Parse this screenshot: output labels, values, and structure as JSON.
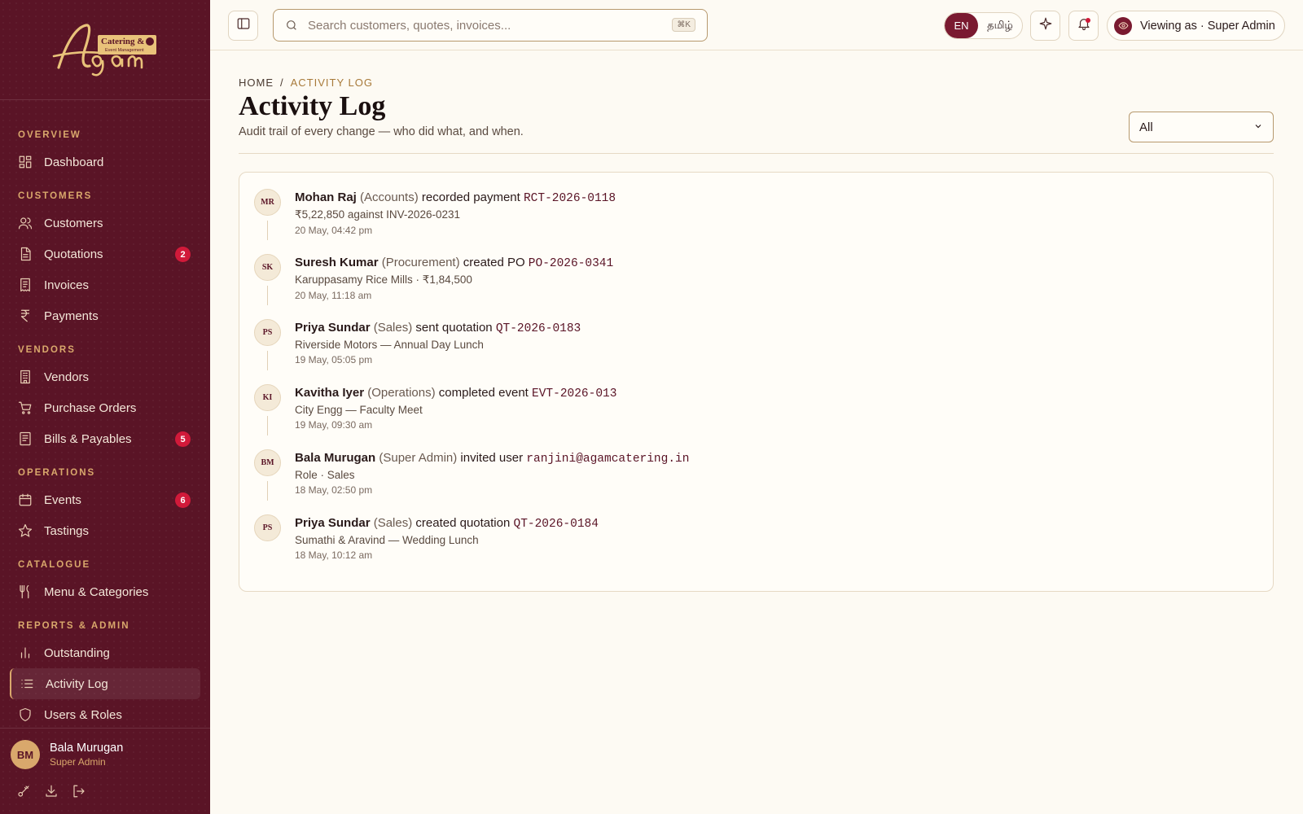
{
  "brand": {
    "logo_line1": "Catering &",
    "logo_line2": "Event Management",
    "logo_script": "Agam"
  },
  "sidebar": {
    "sections": [
      {
        "title": "OVERVIEW",
        "items": [
          {
            "label": "Dashboard",
            "icon": "dashboard-icon"
          }
        ]
      },
      {
        "title": "CUSTOMERS",
        "items": [
          {
            "label": "Customers",
            "icon": "users-icon"
          },
          {
            "label": "Quotations",
            "icon": "file-icon",
            "badge": "2"
          },
          {
            "label": "Invoices",
            "icon": "receipt-icon"
          },
          {
            "label": "Payments",
            "icon": "rupee-icon"
          }
        ]
      },
      {
        "title": "VENDORS",
        "items": [
          {
            "label": "Vendors",
            "icon": "building-icon"
          },
          {
            "label": "Purchase Orders",
            "icon": "cart-icon"
          },
          {
            "label": "Bills & Payables",
            "icon": "bill-icon",
            "badge": "5"
          }
        ]
      },
      {
        "title": "OPERATIONS",
        "items": [
          {
            "label": "Events",
            "icon": "calendar-icon",
            "badge": "6"
          },
          {
            "label": "Tastings",
            "icon": "star-icon"
          }
        ]
      },
      {
        "title": "CATALOGUE",
        "items": [
          {
            "label": "Menu & Categories",
            "icon": "utensils-icon"
          }
        ]
      },
      {
        "title": "REPORTS & ADMIN",
        "items": [
          {
            "label": "Outstanding",
            "icon": "bar-chart-icon"
          },
          {
            "label": "Activity Log",
            "icon": "list-icon",
            "active": true
          },
          {
            "label": "Users & Roles",
            "icon": "shield-icon"
          }
        ]
      }
    ],
    "user": {
      "initials": "BM",
      "name": "Bala Murugan",
      "role": "Super Admin"
    }
  },
  "topbar": {
    "search_placeholder": "Search customers, quotes, invoices...",
    "shortcut": "⌘K",
    "lang_en": "EN",
    "lang_ta": "தமிழ்",
    "viewing_as": "Viewing as · Super Admin"
  },
  "page": {
    "breadcrumb_home": "HOME",
    "breadcrumb_sep": "/",
    "breadcrumb_current": "ACTIVITY LOG",
    "title": "Activity Log",
    "subtitle": "Audit trail of every change — who did what, and when.",
    "filter_value": "All"
  },
  "activity": [
    {
      "initials": "MR",
      "name": "Mohan Raj",
      "role": "(Accounts)",
      "action": "recorded payment",
      "ref": "RCT-2026-0118",
      "detail": "₹5,22,850 against INV-2026-0231",
      "time": "20 May, 04:42 pm"
    },
    {
      "initials": "SK",
      "name": "Suresh Kumar",
      "role": "(Procurement)",
      "action": "created PO",
      "ref": "PO-2026-0341",
      "detail": "Karuppasamy Rice Mills · ₹1,84,500",
      "time": "20 May, 11:18 am"
    },
    {
      "initials": "PS",
      "name": "Priya Sundar",
      "role": "(Sales)",
      "action": "sent quotation",
      "ref": "QT-2026-0183",
      "detail": "Riverside Motors — Annual Day Lunch",
      "time": "19 May, 05:05 pm"
    },
    {
      "initials": "KI",
      "name": "Kavitha Iyer",
      "role": "(Operations)",
      "action": "completed event",
      "ref": "EVT-2026-013",
      "detail": "City Engg — Faculty Meet",
      "time": "19 May, 09:30 am"
    },
    {
      "initials": "BM",
      "name": "Bala Murugan",
      "role": "(Super Admin)",
      "action": "invited user",
      "ref": "ranjini@agamcatering.in",
      "detail": "Role · Sales",
      "time": "18 May, 02:50 pm"
    },
    {
      "initials": "PS",
      "name": "Priya Sundar",
      "role": "(Sales)",
      "action": "created quotation",
      "ref": "QT-2026-0184",
      "detail": "Sumathi & Aravind — Wedding Lunch",
      "time": "18 May, 10:12 am"
    }
  ]
}
